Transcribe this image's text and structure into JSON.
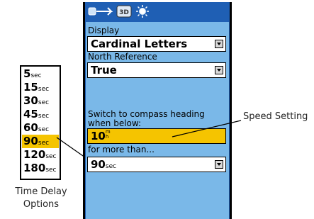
{
  "screen": {
    "tabs": [
      {
        "name": "compass-tab",
        "label": ""
      },
      {
        "name": "3d-tab",
        "label": "3D"
      },
      {
        "name": "sun-tab",
        "label": ""
      }
    ],
    "display_label": "Display",
    "display_value": "Cardinal Letters",
    "north_label": "North Reference",
    "north_value": "True",
    "switch_label_line1": "Switch to compass heading",
    "switch_label_line2": "when below:",
    "speed_value": "10",
    "speed_unit_top": "m",
    "speed_unit_bottom": "h",
    "more_than_label": "for more than...",
    "time_value": "90",
    "time_unit": "sec"
  },
  "time_delay_options": [
    {
      "value": "5",
      "unit": "sec"
    },
    {
      "value": "15",
      "unit": "sec"
    },
    {
      "value": "30",
      "unit": "sec"
    },
    {
      "value": "45",
      "unit": "sec"
    },
    {
      "value": "60",
      "unit": "sec"
    },
    {
      "value": "90",
      "unit": "sec",
      "selected": true
    },
    {
      "value": "120",
      "unit": "sec"
    },
    {
      "value": "180",
      "unit": "sec"
    }
  ],
  "captions": {
    "time_delay_line1": "Time Delay",
    "time_delay_line2": "Options",
    "speed_setting": "Speed Setting"
  },
  "colors": {
    "frame": "#1f5fb4",
    "page_background": "#7ab8e8",
    "highlight": "#f5c400"
  }
}
